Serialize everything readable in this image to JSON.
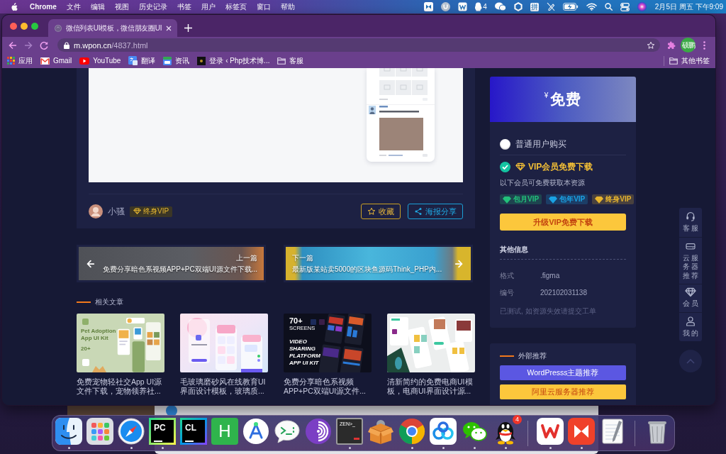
{
  "menu_bar": {
    "app_name": "Chrome",
    "menus": [
      "文件",
      "编辑",
      "视图",
      "历史记录",
      "书签",
      "用户",
      "标签页",
      "窗口",
      "帮助"
    ],
    "qq_badge": "4",
    "input_method": "拼",
    "clock": "2月5日 周五 下午9:09"
  },
  "browser": {
    "tabs": [
      {
        "title": "微信列表UI模板，微信朋友圈UI",
        "selected": true
      }
    ],
    "address": {
      "host": "m.wpon.cn",
      "path": "/4837.html"
    },
    "profile": "硕鹏",
    "bookmarks": [
      {
        "kind": "apps",
        "label": "应用"
      },
      {
        "kind": "mail",
        "label": "Gmail"
      },
      {
        "kind": "video",
        "label": "YouTube"
      },
      {
        "kind": "translate",
        "label": "翻译"
      },
      {
        "kind": "news",
        "label": "资讯"
      },
      {
        "kind": "site",
        "label": "登录 ‹ Php技术博..."
      },
      {
        "kind": "folder",
        "label": "客服"
      }
    ],
    "other_bookmarks": "其他书签"
  },
  "post": {
    "author": "小骚",
    "author_badge": "终身VIP",
    "actions": [
      {
        "kind": "favorite",
        "label": "收藏"
      },
      {
        "kind": "share",
        "label": "海报分享"
      }
    ]
  },
  "post_nav": [
    {
      "kind": "previous",
      "caption": "上一篇",
      "title": "免费分享暗色系视频APP+PC双端UI源文件下载..."
    },
    {
      "kind": "next",
      "caption": "下一篇",
      "title": "最新版某站卖5000的区块鱼源码Think_PHP内..."
    }
  ],
  "related": {
    "title": "相关文章",
    "posts": [
      {
        "thumbnail": {
          "kind": "pet",
          "lines": [
            "Pet Adoption",
            "App UI Kit"
          ],
          "badge": "20+"
        },
        "title": "免费宠物轻社交App UI源文件下载，宠物领养社..."
      },
      {
        "thumbnail": {
          "kind": "glass"
        },
        "title": "毛玻璃磨砂风在线教育UI界面设计模板，玻璃质..."
      },
      {
        "thumbnail": {
          "kind": "dark",
          "badge": "70+",
          "badge_caption": "SCREENS",
          "lines": [
            "VIDEO",
            "SHARING",
            "PLATFORM",
            "APP UI KIT"
          ]
        },
        "title": "免费分享暗色系视频APP+PC双端UI源文件..."
      },
      {
        "thumbnail": {
          "kind": "shop"
        },
        "title": "清新简约的免费电商UI模板，电商UI界面设计源..."
      }
    ]
  },
  "purchase": {
    "price": "$^{¥}$免费",
    "options": [
      {
        "kind": "standard",
        "label": "普通用户购买",
        "selected": false
      },
      {
        "kind": "vip",
        "label": "VIP会员免费下载",
        "selected": true
      }
    ],
    "hint": "以下会员可免费获取本资源",
    "tags": [
      {
        "label": "包月VIP",
        "color": "#22c17a"
      },
      {
        "label": "包年VIP",
        "color": "#1aa2e4"
      },
      {
        "label": "终身VIP",
        "color": "#e7b42e"
      }
    ],
    "button": "升级VIP免费下载",
    "info_title": "其他信息",
    "info": [
      {
        "label": "格式",
        "value": ".figma"
      },
      {
        "label": "编号",
        "value": "202102031138"
      }
    ],
    "note": "已测试, 如资源失效请提交工单"
  },
  "external": {
    "title": "外部推荐",
    "buttons": [
      {
        "kind": "primary",
        "label": "WordPresss主题推荐"
      },
      {
        "kind": "warning",
        "label": "阿里云服务器推荐"
      }
    ]
  },
  "floating_tools": [
    {
      "kind": "headset",
      "label": "客服"
    },
    {
      "kind": "server",
      "label": "云服务器推荐"
    },
    {
      "kind": "diamond",
      "label": "会员"
    },
    {
      "kind": "user",
      "label": "我的"
    }
  ],
  "dock": {
    "items": [
      {
        "kind": "finder",
        "running": true
      },
      {
        "kind": "launchpad",
        "running": false
      },
      {
        "kind": "safari",
        "running": true
      },
      {
        "kind": "pycharm",
        "glyph": "PC",
        "running": true
      },
      {
        "kind": "clion",
        "glyph": "CL",
        "running": false
      },
      {
        "kind": "hbuilder",
        "glyph": "H",
        "running": false
      },
      {
        "kind": "android",
        "running": false
      },
      {
        "kind": "terminal",
        "running": false
      },
      {
        "kind": "tor",
        "running": false
      },
      {
        "kind": "zen",
        "glyph": "ZEN>_",
        "running": true
      },
      {
        "kind": "mamp",
        "running": false
      },
      {
        "kind": "chrome",
        "running": true
      },
      {
        "kind": "netdisk",
        "running": true
      },
      {
        "kind": "wechat",
        "running": true
      },
      {
        "kind": "qq",
        "badge": "4",
        "running": true
      },
      {
        "kind": "separator"
      },
      {
        "kind": "wps",
        "running": true
      },
      {
        "kind": "player",
        "running": true
      },
      {
        "kind": "textedit",
        "running": false
      },
      {
        "kind": "separator"
      },
      {
        "kind": "trash",
        "running": false
      }
    ]
  }
}
